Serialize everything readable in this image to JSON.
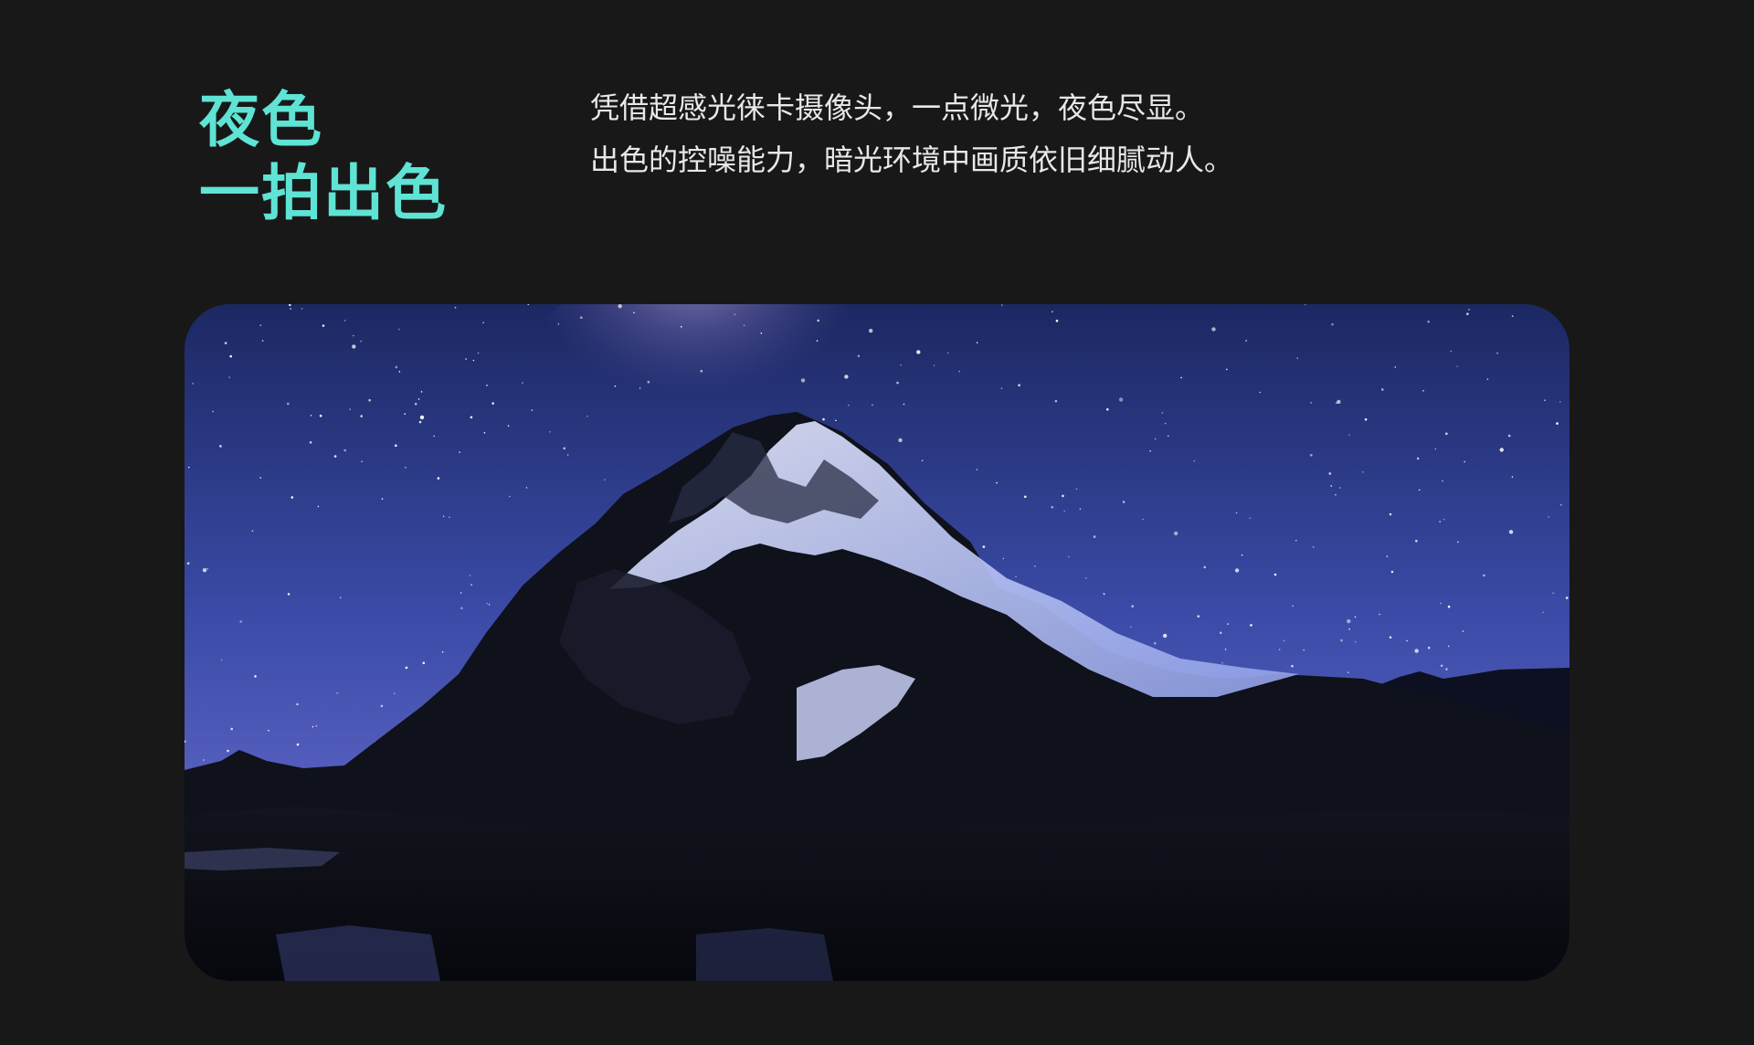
{
  "headline": {
    "line1": "夜色",
    "line2": "一拍出色"
  },
  "description": {
    "line1": "凭借超感光徕卡摄像头，一点微光，夜色尽显。",
    "line2": "出色的控噪能力，暗光环境中画质依旧细腻动人。"
  },
  "colors": {
    "accent": "#5ee3d4",
    "background": "#181818",
    "body_text": "#e8e8e8"
  }
}
